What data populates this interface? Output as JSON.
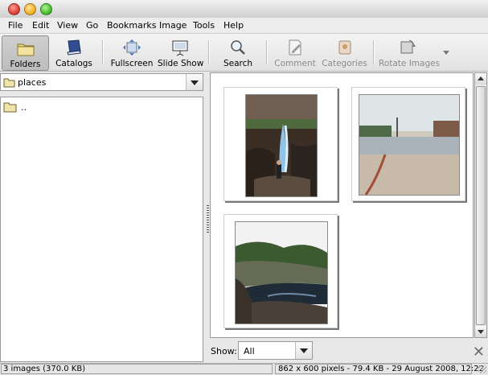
{
  "menu": [
    "File",
    "Edit",
    "View",
    "Go",
    "Bookmarks",
    "Image",
    "Tools",
    "Help"
  ],
  "toolbar": {
    "folders": "Folders",
    "catalogs": "Catalogs",
    "fullscreen": "Fullscreen",
    "slideshow": "Slide Show",
    "search": "Search",
    "comment": "Comment",
    "categories": "Categories",
    "rotate": "Rotate Images"
  },
  "location": {
    "value": "places"
  },
  "tree": {
    "items": [
      ".."
    ]
  },
  "show": {
    "label": "Show:",
    "value": "All"
  },
  "status": {
    "left": "3 images (370.0 KB)",
    "right": "862 x 600 pixels - 79.4 KB - 29 August 2008, 12:22"
  }
}
